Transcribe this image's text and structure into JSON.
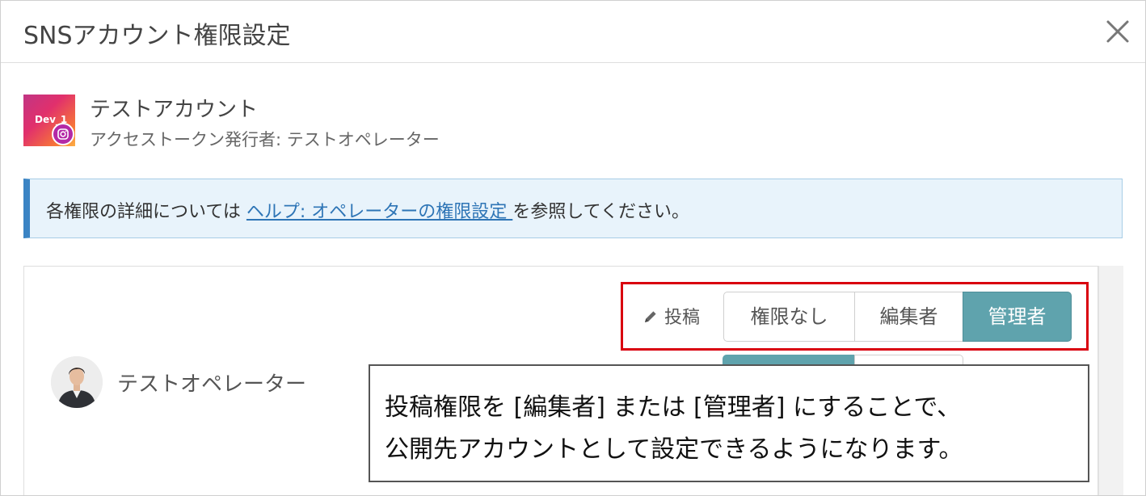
{
  "modal": {
    "title": "SNSアカウント権限設定",
    "close_icon": "close-icon"
  },
  "account": {
    "avatar_text": "Dev_1",
    "badge_icon": "instagram-icon",
    "name": "テストアカウント",
    "token_issuer": "アクセストークン発行者: テストオペレーター"
  },
  "info": {
    "text_before": "各権限の詳細については ",
    "link": "ヘルプ: オペレーターの権限設定 ",
    "text_after": "を参照してください。",
    "accent_color": "#3b84c4"
  },
  "operator": {
    "name": "テストオペレーター",
    "permission": {
      "label": "投稿",
      "icon": "pencil-icon",
      "options": [
        "権限なし",
        "編集者",
        "管理者"
      ],
      "selected": "管理者"
    }
  },
  "callout": {
    "line1": "投稿権限を [編集者] または [管理者] にすることで、",
    "line2": "公開先アカウントとして設定できるようになります。"
  },
  "colors": {
    "active_button": "#5fa3ad",
    "highlight_frame": "#d9000f",
    "link": "#2e75b6"
  }
}
